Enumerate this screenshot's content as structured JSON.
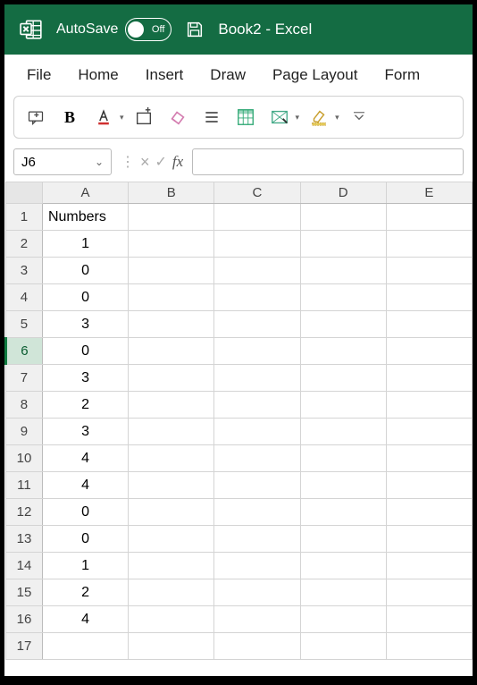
{
  "titlebar": {
    "autosave_label": "AutoSave",
    "toggle_state": "Off",
    "doc_title": "Book2  -  Excel"
  },
  "menubar": {
    "items": [
      "File",
      "Home",
      "Insert",
      "Draw",
      "Page Layout",
      "Form"
    ]
  },
  "formula": {
    "namebox": "J6",
    "fx_label": "fx",
    "value": ""
  },
  "grid": {
    "columns": [
      "A",
      "B",
      "C",
      "D",
      "E"
    ],
    "active_row": 6,
    "rows": [
      {
        "n": 1,
        "A": "Numbers",
        "type": "text"
      },
      {
        "n": 2,
        "A": "1",
        "type": "num"
      },
      {
        "n": 3,
        "A": "0",
        "type": "num"
      },
      {
        "n": 4,
        "A": "0",
        "type": "num"
      },
      {
        "n": 5,
        "A": "3",
        "type": "num"
      },
      {
        "n": 6,
        "A": "0",
        "type": "num"
      },
      {
        "n": 7,
        "A": "3",
        "type": "num"
      },
      {
        "n": 8,
        "A": "2",
        "type": "num"
      },
      {
        "n": 9,
        "A": "3",
        "type": "num"
      },
      {
        "n": 10,
        "A": "4",
        "type": "num"
      },
      {
        "n": 11,
        "A": "4",
        "type": "num"
      },
      {
        "n": 12,
        "A": "0",
        "type": "num"
      },
      {
        "n": 13,
        "A": "0",
        "type": "num"
      },
      {
        "n": 14,
        "A": "1",
        "type": "num"
      },
      {
        "n": 15,
        "A": "2",
        "type": "num"
      },
      {
        "n": 16,
        "A": "4",
        "type": "num"
      },
      {
        "n": 17,
        "A": "",
        "type": "num"
      }
    ]
  }
}
